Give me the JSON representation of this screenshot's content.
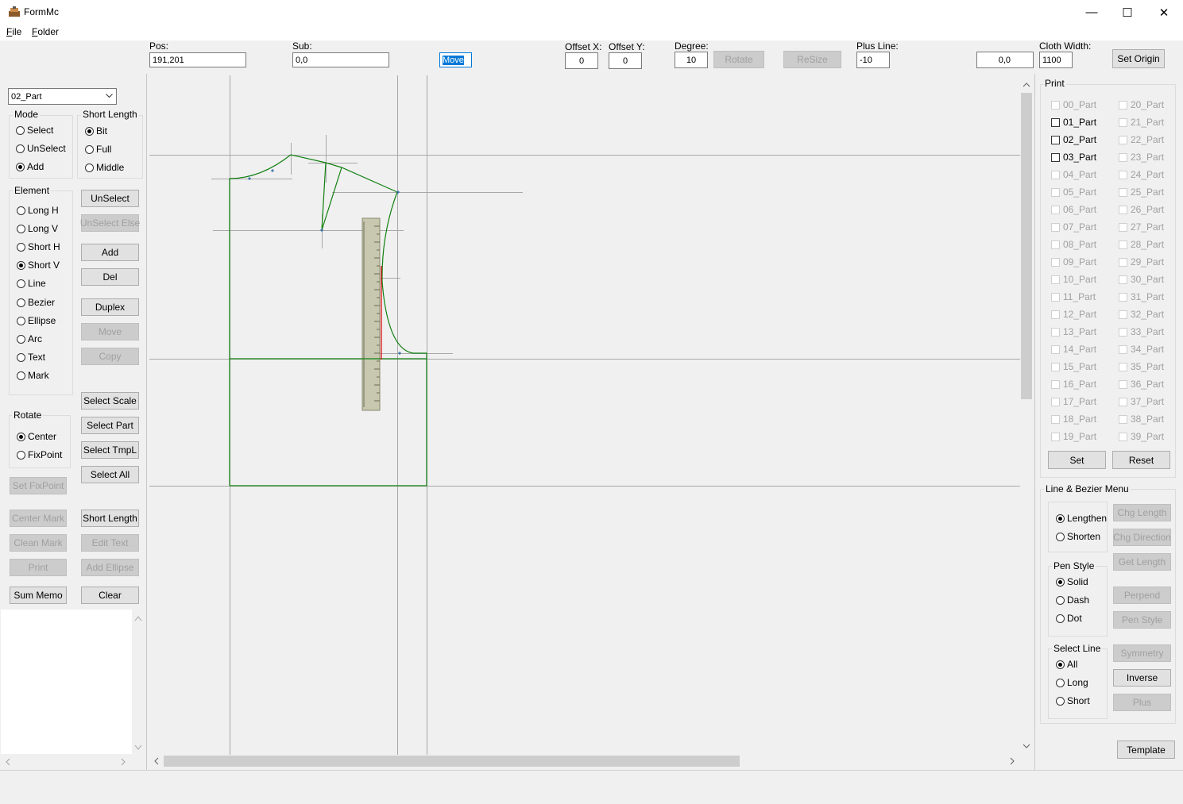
{
  "window": {
    "title": "FormMc",
    "minimize": "—",
    "maximize": "☐",
    "close": "✕"
  },
  "menu": [
    {
      "label": "File",
      "hotkey": "F",
      "rest": "ile"
    },
    {
      "label": "Folder",
      "hotkey": "F",
      "rest": "older"
    }
  ],
  "toolbar": {
    "pos_label": "Pos:",
    "pos_value": "191,201",
    "sub_label": "Sub:",
    "sub_value": "0,0",
    "move_value": "Move",
    "offset_x_label": "Offset X:",
    "offset_x_value": "0",
    "offset_y_label": "Offset Y:",
    "offset_y_value": "0",
    "degree_label": "Degree:",
    "degree_value": "10",
    "rotate_label": "Rotate",
    "resize_label": "ReSize",
    "plus_line_label": "Plus Line:",
    "plus_line_value": "-10",
    "coord_value": "0,0",
    "cloth_width_label": "Cloth Width:",
    "cloth_width_value": "1100",
    "set_origin_label": "Set Origin"
  },
  "left": {
    "part_select": "02_Part",
    "mode": {
      "title": "Mode",
      "options": [
        "Select",
        "UnSelect",
        "Add"
      ],
      "selected": "Add"
    },
    "short_length": {
      "title": "Short Length",
      "options": [
        "Bit",
        "Full",
        "Middle"
      ],
      "selected": "Bit"
    },
    "element": {
      "title": "Element",
      "options": [
        "Long H",
        "Long V",
        "Short H",
        "Short V",
        "Line",
        "Bezier",
        "Ellipse",
        "Arc",
        "Text",
        "Mark"
      ],
      "selected": "Short V"
    },
    "rotate": {
      "title": "Rotate",
      "options": [
        "Center",
        "FixPoint"
      ],
      "selected": "Center"
    },
    "buttons": {
      "unselect": "UnSelect",
      "unselect_else": "UnSelect Else",
      "add": "Add",
      "del": "Del",
      "duplex": "Duplex",
      "move": "Move",
      "copy": "Copy",
      "select_scale": "Select Scale",
      "select_part": "Select Part",
      "select_tmpl": "Select TmpL",
      "select_all": "Select All",
      "set_fixpoint": "Set FixPoint",
      "center_mark": "Center Mark",
      "short_length": "Short Length",
      "clean_mark": "Clean Mark",
      "edit_text": "Edit Text",
      "print": "Print",
      "add_ellipse": "Add Ellipse",
      "sum_memo": "Sum Memo",
      "clear": "Clear"
    }
  },
  "right": {
    "print_title": "Print",
    "parts_col1": [
      "00_Part",
      "01_Part",
      "02_Part",
      "03_Part",
      "04_Part",
      "05_Part",
      "06_Part",
      "07_Part",
      "08_Part",
      "09_Part",
      "10_Part",
      "11_Part",
      "12_Part",
      "13_Part",
      "14_Part",
      "15_Part",
      "16_Part",
      "17_Part",
      "18_Part",
      "19_Part"
    ],
    "parts_col2": [
      "20_Part",
      "21_Part",
      "22_Part",
      "23_Part",
      "24_Part",
      "25_Part",
      "26_Part",
      "27_Part",
      "28_Part",
      "29_Part",
      "30_Part",
      "31_Part",
      "32_Part",
      "33_Part",
      "34_Part",
      "35_Part",
      "36_Part",
      "37_Part",
      "38_Part",
      "39_Part"
    ],
    "set_label": "Set",
    "reset_label": "Reset",
    "line_bezier_title": "Line & Bezier Menu",
    "len_options": [
      "Lengthen",
      "Shorten"
    ],
    "len_selected": "Lengthen",
    "pen_style": {
      "title": "Pen Style",
      "options": [
        "Solid",
        "Dash",
        "Dot"
      ],
      "selected": "Solid"
    },
    "select_line": {
      "title": "Select Line",
      "options": [
        "All",
        "Long",
        "Short"
      ],
      "selected": "All"
    },
    "buttons": {
      "chg_length": "Chg Length",
      "chg_direction": "Chg Direction",
      "get_length": "Get Length",
      "perpend": "Perpend",
      "pen_style": "Pen Style",
      "symmetry": "Symmetry",
      "inverse": "Inverse",
      "plus": "Plus"
    },
    "template_label": "Template"
  },
  "colors": {
    "pattern_line": "#108010",
    "grid_line": "#a0a0a0",
    "ruler": "#c8c8b0",
    "highlight": "#e00000",
    "selection": "#0078d7"
  }
}
